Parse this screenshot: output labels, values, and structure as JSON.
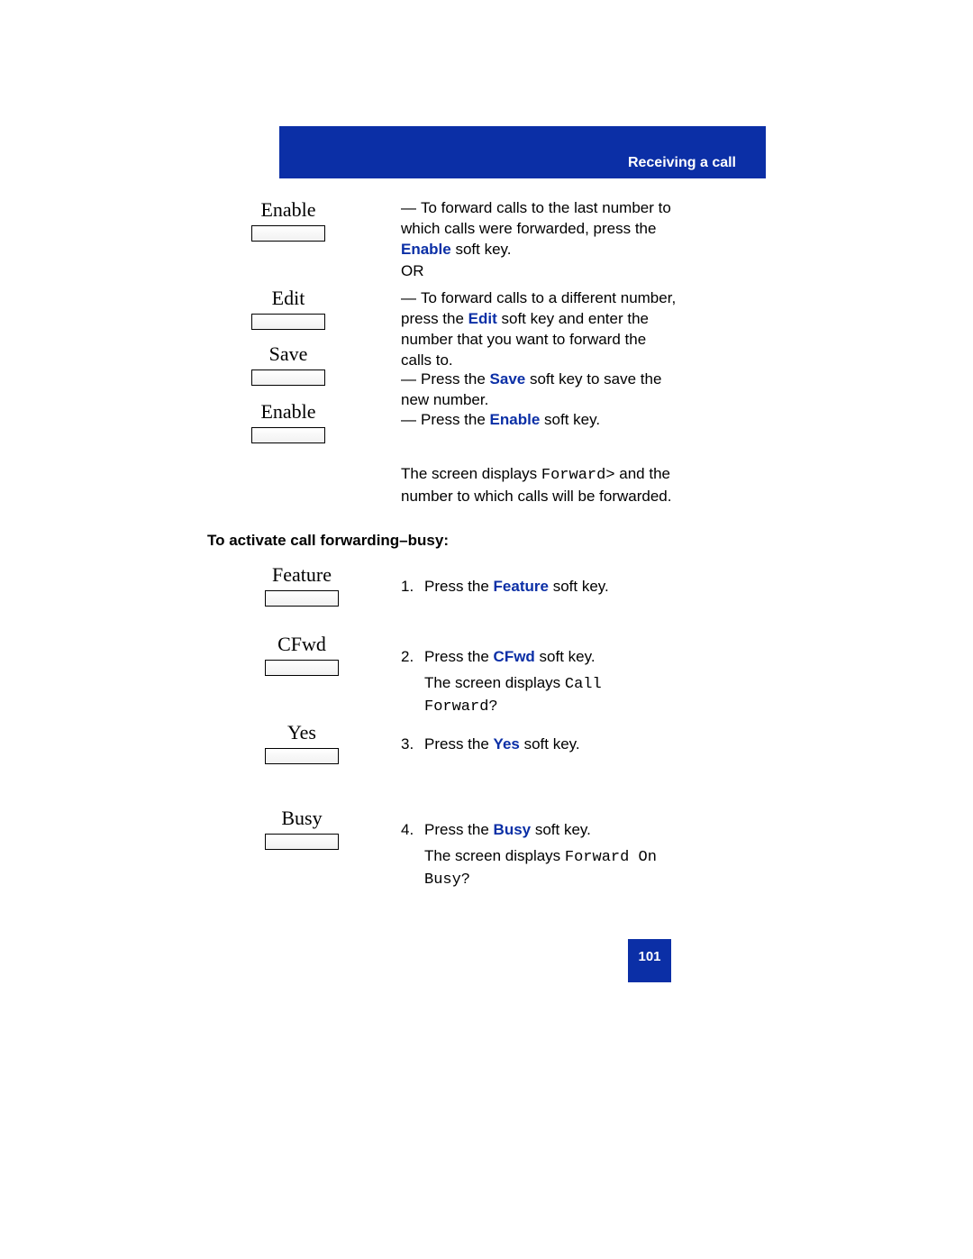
{
  "header": {
    "title": "Receiving a call"
  },
  "softkeys": {
    "enable": "Enable",
    "edit": "Edit",
    "save": "Save",
    "enable2": "Enable",
    "feature": "Feature",
    "cfwd": "CFwd",
    "yes": "Yes",
    "busy": "Busy"
  },
  "top": {
    "line1a": "To forward calls to the last number to which calls were forwarded, press the ",
    "enable_kw": "Enable",
    "line1b": " soft key.",
    "or": "OR",
    "line2a": "To forward calls to a different number, press the ",
    "edit_kw": "Edit",
    "line2b": " soft key and enter the number that you want to forward the calls to.",
    "line3a": "Press the ",
    "save_kw": "Save",
    "line3b": " soft key to save the new number.",
    "line4a": "Press the ",
    "enable2_kw": "Enable",
    "line4b": " soft key.",
    "screen_a": "The screen displays ",
    "screen_code": "Forward>",
    "screen_b": " and the number to which calls will be forwarded."
  },
  "section_heading": "To activate call forwarding–busy:",
  "steps": {
    "s1a": "Press the ",
    "s1kw": "Feature",
    "s1b": " soft key.",
    "s2a": "Press the ",
    "s2kw": "CFwd",
    "s2b": " soft key.",
    "s2c": "The screen displays ",
    "s2code": "Call Forward?",
    "s3a": "Press the ",
    "s3kw": "Yes",
    "s3b": " soft key.",
    "s4a": "Press the ",
    "s4kw": "Busy",
    "s4b": " soft key.",
    "s4c": "The screen displays ",
    "s4code": "Forward On Busy?"
  },
  "page_number": "101"
}
